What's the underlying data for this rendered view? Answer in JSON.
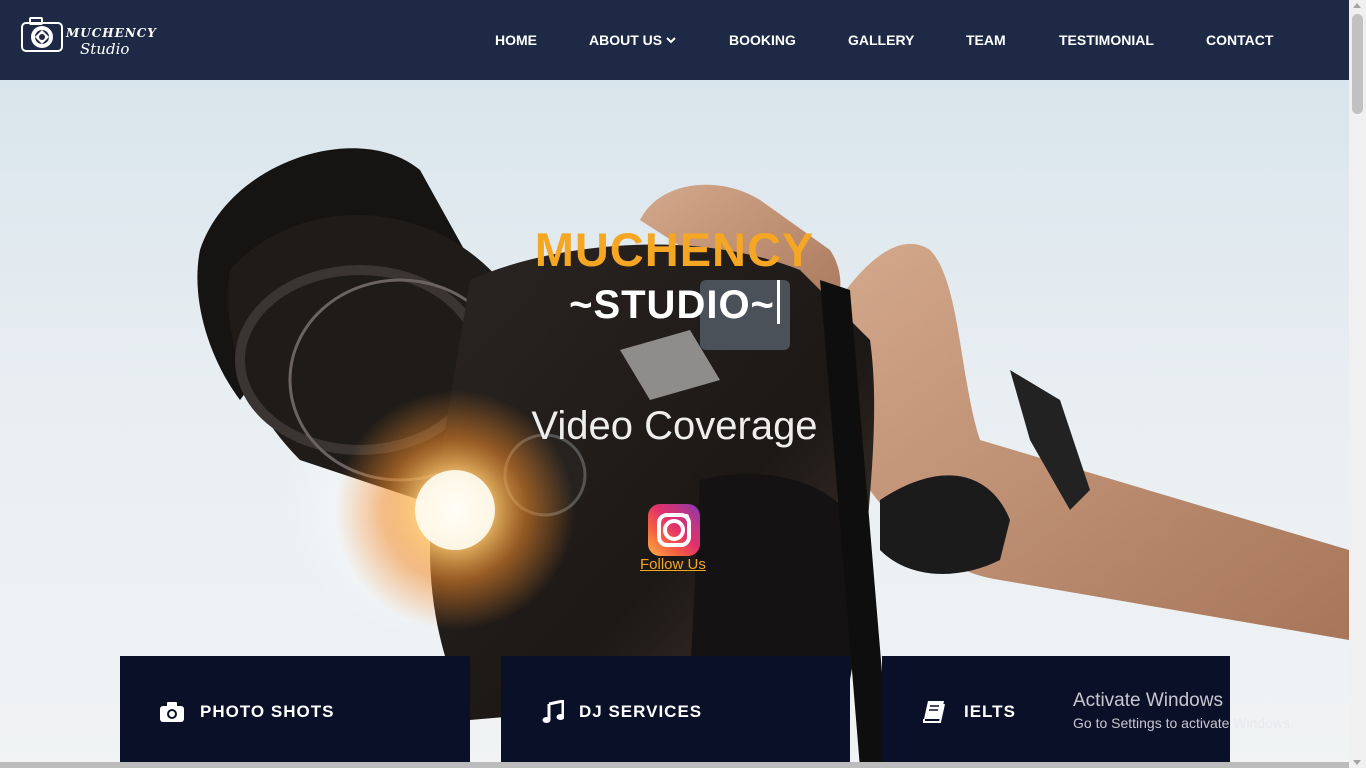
{
  "brand": {
    "logo_text": "MUCHENCY",
    "logo_sub": "Studio"
  },
  "nav": {
    "items": [
      {
        "label": "HOME"
      },
      {
        "label": "ABOUT US"
      },
      {
        "label": "BOOKING"
      },
      {
        "label": "GALLERY"
      },
      {
        "label": "TEAM"
      },
      {
        "label": "TESTIMONIAL"
      },
      {
        "label": "CONTACT"
      }
    ]
  },
  "hero": {
    "title": "MUCHENCY",
    "subtitle": "~STUDIO~",
    "service": "Video Coverage",
    "follow": "Follow Us",
    "social_icon": "instagram-icon"
  },
  "cards": [
    {
      "label": "PHOTO SHOTS",
      "icon": "camera-icon"
    },
    {
      "label": "DJ SERVICES",
      "icon": "music-icon"
    },
    {
      "label": "IELTS",
      "icon": "book-icon"
    }
  ],
  "watermark": {
    "title": "Activate Windows",
    "subtitle": "Go to Settings to activate Windows."
  },
  "colors": {
    "nav_bg": "#1e2a45",
    "accent": "#f5a623",
    "card_bg": "#0b1029"
  }
}
